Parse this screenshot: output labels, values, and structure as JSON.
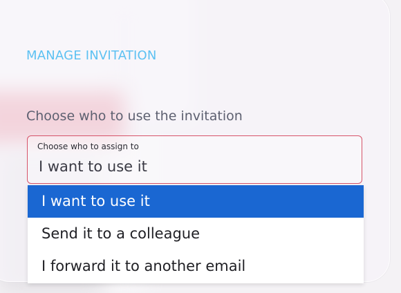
{
  "dialog": {
    "title": "MANAGE INVITATION",
    "field_label": "Choose who to use the invitation",
    "select": {
      "caption": "Choose who to assign to",
      "value": "I want to use it"
    },
    "options": [
      {
        "label": "I want to use it",
        "selected": true
      },
      {
        "label": "Send it to a colleague",
        "selected": false
      },
      {
        "label": "I forward it to another email",
        "selected": false
      }
    ]
  },
  "colors": {
    "title": "#5dc1f2",
    "select_border": "#d65268",
    "option_highlight": "#1a67d2"
  }
}
